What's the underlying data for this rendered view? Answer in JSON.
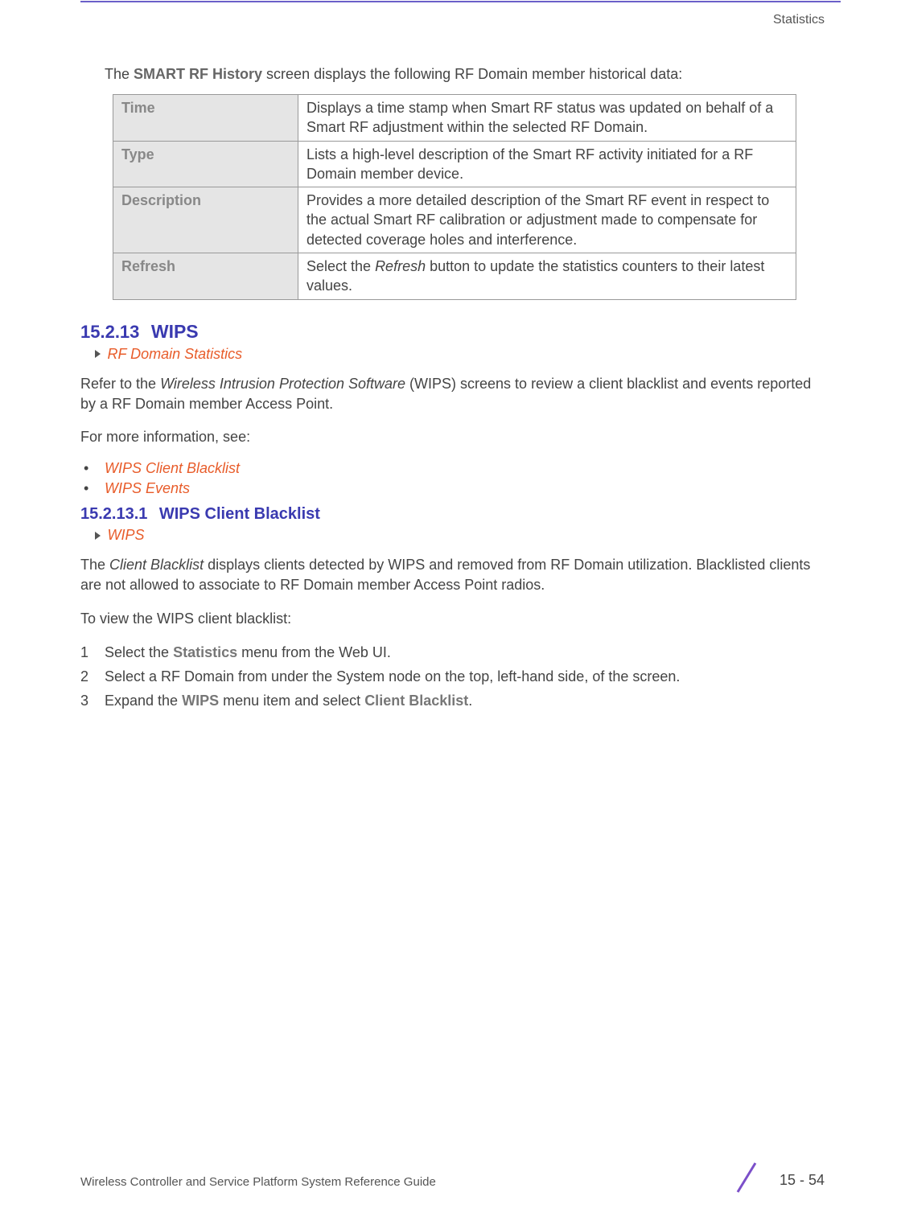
{
  "header": {
    "section_label": "Statistics"
  },
  "intro": {
    "pre": "The ",
    "bold": "SMART RF History",
    "post": " screen displays the following RF Domain member historical data:"
  },
  "table_rows": [
    {
      "term": "Time",
      "def_pre": "Displays a time stamp when Smart RF status was updated on behalf of a Smart RF adjustment within the selected RF Domain.",
      "def_italic": "",
      "def_post": ""
    },
    {
      "term": "Type",
      "def_pre": "Lists a high-level description of the Smart RF activity initiated for a RF Domain member device.",
      "def_italic": "",
      "def_post": ""
    },
    {
      "term": "Description",
      "def_pre": "Provides a more detailed description of the Smart RF event in respect to the actual Smart RF calibration or adjustment made to compensate for detected coverage holes and interference.",
      "def_italic": "",
      "def_post": ""
    },
    {
      "term": "Refresh",
      "def_pre": "Select the ",
      "def_italic": "Refresh",
      "def_post": " button to update the statistics counters to their latest values."
    }
  ],
  "section": {
    "num": "15.2.13",
    "title": "WIPS",
    "breadcrumb": "RF Domain Statistics",
    "para_pre": "Refer to the ",
    "para_italic": "Wireless Intrusion Protection Software",
    "para_post": " (WIPS) screens to review a client blacklist and events reported by a RF Domain member Access Point.",
    "more_info": "For more information, see:",
    "bullets": [
      "WIPS Client Blacklist",
      "WIPS Events"
    ]
  },
  "subsection": {
    "num": "15.2.13.1",
    "title": "WIPS Client Blacklist",
    "breadcrumb": "WIPS",
    "para_pre": "The ",
    "para_italic": "Client Blacklist",
    "para_post": " displays clients detected by WIPS and removed from RF Domain utilization. Blacklisted clients are not allowed to associate to RF Domain member Access Point radios.",
    "steps_intro": "To view the WIPS client blacklist:",
    "steps": [
      {
        "pre": "Select the ",
        "b1": "Statistics",
        "mid": " menu from the Web UI.",
        "b2": "",
        "post": ""
      },
      {
        "pre": "Select a RF Domain from under the System node on the top, left-hand side, of the screen.",
        "b1": "",
        "mid": "",
        "b2": "",
        "post": ""
      },
      {
        "pre": "Expand the ",
        "b1": "WIPS",
        "mid": " menu item and select ",
        "b2": "Client Blacklist",
        "post": "."
      }
    ]
  },
  "footer": {
    "left": "Wireless Controller and Service Platform System Reference Guide",
    "right": "15 - 54"
  }
}
